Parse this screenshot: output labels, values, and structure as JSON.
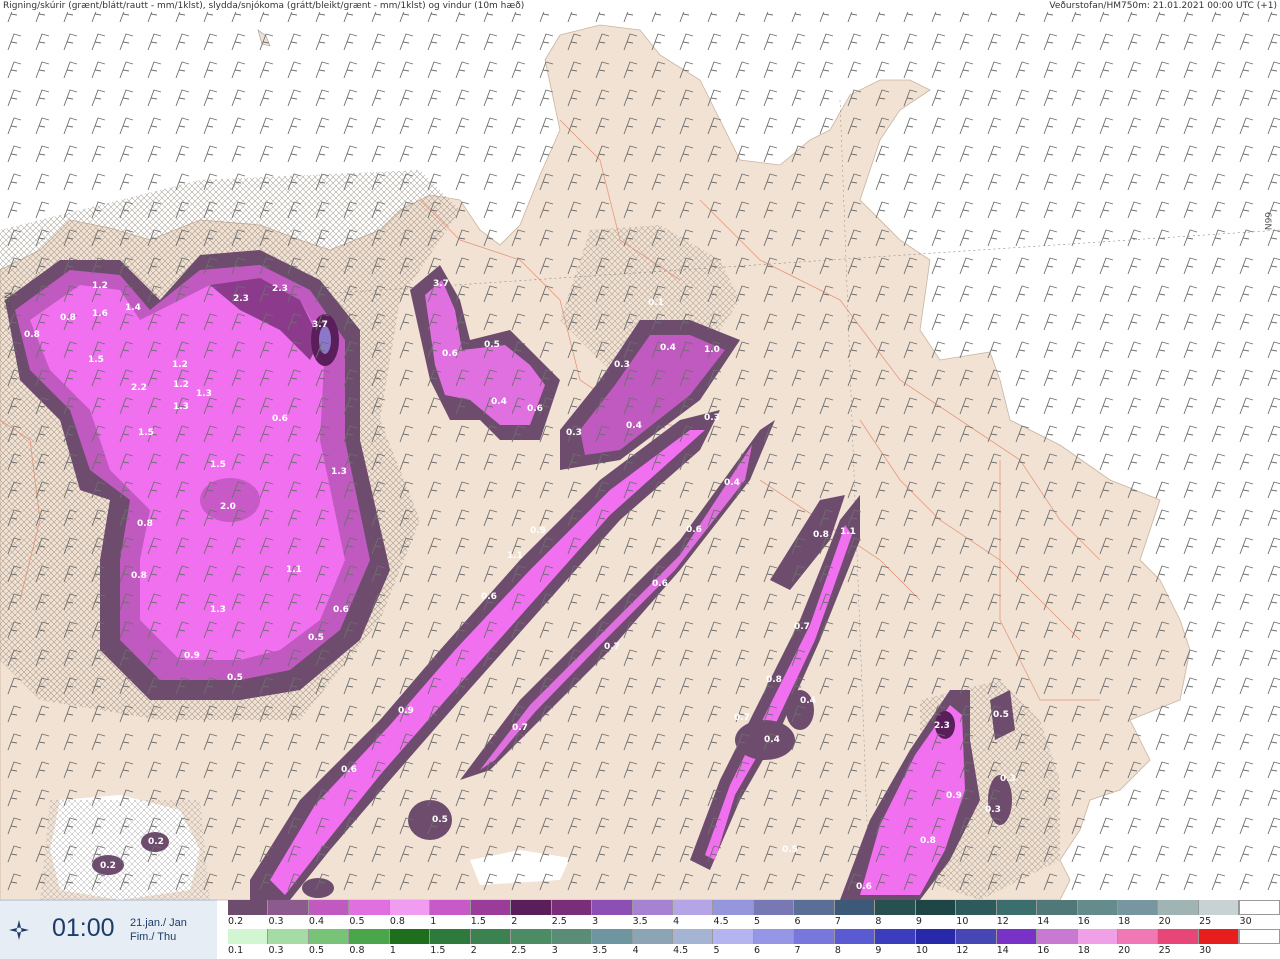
{
  "header": {
    "left_title": "Rigning/skúrir (grænt/blátt/rautt - mm/1klst), slydda/snjókoma (grátt/bleikt/grænt - mm/1klst) og vindur (10m hæð)",
    "right_title": "Veðurstofan/HM750m: 21.01.2021 00:00 UTC (+1)"
  },
  "map_labels": {
    "lat_right": "66N",
    "lat_left": "66N"
  },
  "time_box": {
    "icon": "compass-icon",
    "time": "01:00",
    "date_line1": "21.jan./ Jan",
    "date_line2": "Fim./ Thu"
  },
  "legend": {
    "snow_row": {
      "labels": [
        "0.2",
        "0.3",
        "0.4",
        "0.5",
        "0.8",
        "1",
        "1.5",
        "2",
        "2.5",
        "3",
        "3.5",
        "4",
        "4.5",
        "5",
        "6",
        "7",
        "8",
        "9",
        "10",
        "12",
        "14",
        "16",
        "18",
        "20",
        "25",
        "30"
      ],
      "colors": [
        "#6e4c6e",
        "#8c5a8c",
        "#c05ac0",
        "#e070e0",
        "#f09cf0",
        "#c85ac8",
        "#9b3c9b",
        "#5a1e5a",
        "#7a2e7a",
        "#8c50b4",
        "#a582d2",
        "#b4a5e6",
        "#9696dc",
        "#7878b4",
        "#5a6e96",
        "#3c5a78",
        "#285050",
        "#1e4646",
        "#2d5a5a",
        "#3c6e6e",
        "#507878",
        "#648c8c",
        "#7896a0",
        "#a0b4b4",
        "#c8d2d2"
      ]
    },
    "rain_row": {
      "labels": [
        "0.1",
        "0.3",
        "0.5",
        "0.8",
        "1",
        "1.5",
        "2",
        "2.5",
        "3",
        "3.5",
        "4",
        "4.5",
        "5",
        "6",
        "7",
        "8",
        "9",
        "10",
        "12",
        "14",
        "16",
        "18",
        "20",
        "25",
        "30"
      ],
      "colors": [
        "#d2f5d2",
        "#a5dca5",
        "#78c378",
        "#4ba54b",
        "#1e6e1e",
        "#2d7a3c",
        "#3c8250",
        "#4b8c64",
        "#5a8c78",
        "#6e96a0",
        "#8ca5b4",
        "#a5b4d2",
        "#b4b4f0",
        "#9696e6",
        "#7878dc",
        "#5a5ad2",
        "#3c3cbe",
        "#2828aa",
        "#4646b4",
        "#7832c8",
        "#c87ad2",
        "#f0a0e6",
        "#f078b4",
        "#e64678",
        "#e61e1e"
      ]
    }
  },
  "precip_values": [
    "1.2",
    "1.4",
    "0.8",
    "0.8",
    "1.6",
    "1.5",
    "2.3",
    "2.3",
    "3.7",
    "3.7",
    "0.1",
    "0.3",
    "0.4",
    "1.0",
    "0.6",
    "0.5",
    "0.3",
    "1.2",
    "2.2",
    "1.2",
    "1.3",
    "1.3",
    "1.5",
    "0.4",
    "0.6",
    "0.4",
    "0.6",
    "0.3",
    "0.4",
    "0.6",
    "1.3",
    "1.5",
    "2.0",
    "0.8",
    "0.8",
    "1.1",
    "1.3",
    "0.9",
    "0.5",
    "0.6",
    "0.5",
    "1.1",
    "0.9",
    "0.6",
    "0.6",
    "1.1",
    "0.8",
    "0.7",
    "0.7",
    "0.9",
    "0.6",
    "0.7",
    "0.8",
    "0.4",
    "0.7",
    "0.4",
    "2.3",
    "0.5",
    "0.3",
    "0.3",
    "0.9",
    "0.8",
    "0.5",
    "0.5",
    "0.2",
    "0.2",
    "0.6"
  ]
}
